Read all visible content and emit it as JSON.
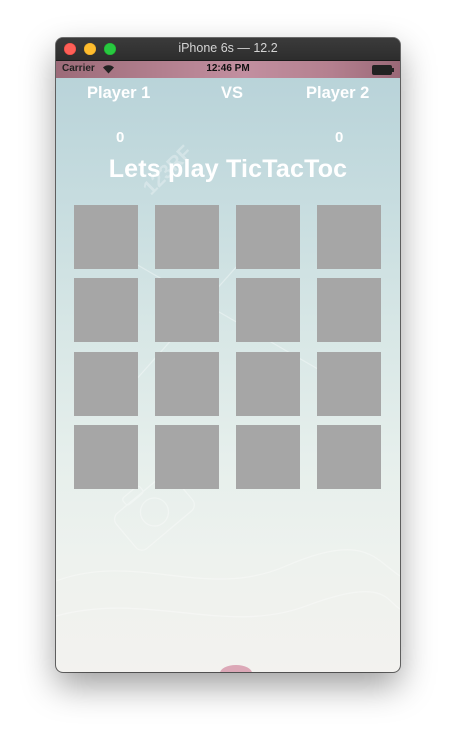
{
  "window": {
    "title": "iPhone 6s — 12.2"
  },
  "status_bar": {
    "carrier": "Carrier",
    "time": "12:46 PM"
  },
  "header": {
    "player1_label": "Player 1",
    "vs_label": "VS",
    "player2_label": "Player 2"
  },
  "scores": {
    "player1": "0",
    "player2": "0"
  },
  "game": {
    "title": "Lets play TicTacToc"
  },
  "board": {
    "rows": 4,
    "columns": 4,
    "cells": [
      "",
      "",
      "",
      "",
      "",
      "",
      "",
      "",
      "",
      "",
      "",
      "",
      "",
      "",
      "",
      ""
    ]
  },
  "watermark": {
    "text": "123RF"
  },
  "colors": {
    "cell": "#a6a6a6",
    "text": "#ffffff",
    "background_top": "#b7d2d8",
    "background_bottom": "#f3f2ef"
  }
}
